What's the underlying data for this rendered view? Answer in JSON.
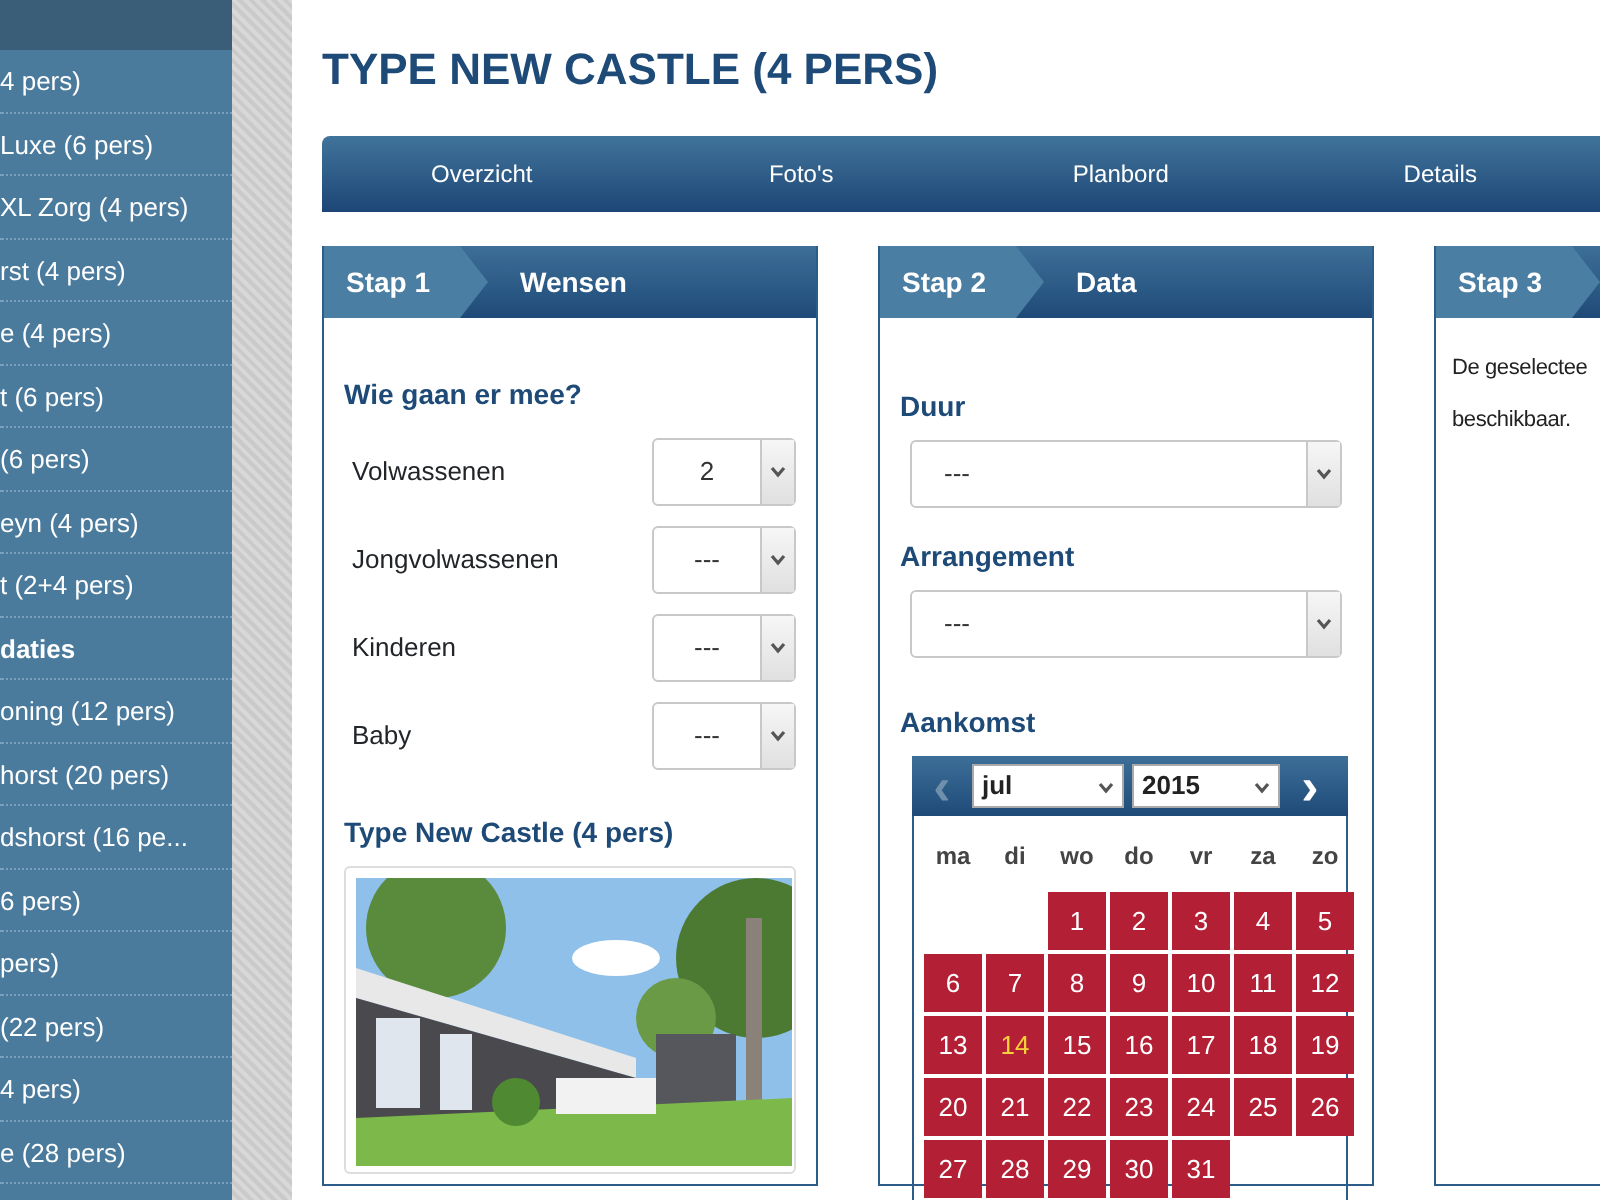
{
  "sidebar": {
    "items": [
      {
        "label": "4 pers)",
        "kind": "link"
      },
      {
        "label": "Luxe (6 pers)",
        "kind": "link"
      },
      {
        "label": "XL Zorg (4 pers)",
        "kind": "link"
      },
      {
        "label": "rst (4 pers)",
        "kind": "link"
      },
      {
        "label": "e (4 pers)",
        "kind": "link"
      },
      {
        "label": "t (6 pers)",
        "kind": "link"
      },
      {
        "label": "(6 pers)",
        "kind": "link"
      },
      {
        "label": "eyn (4 pers)",
        "kind": "link"
      },
      {
        "label": "t (2+4 pers)",
        "kind": "link"
      },
      {
        "label": "daties",
        "kind": "heading"
      },
      {
        "label": "oning (12 pers)",
        "kind": "link"
      },
      {
        "label": "horst (20 pers)",
        "kind": "link"
      },
      {
        "label": "dshorst (16 pe...",
        "kind": "link"
      },
      {
        "label": "6 pers)",
        "kind": "link"
      },
      {
        "label": "pers)",
        "kind": "link"
      },
      {
        "label": "(22 pers)",
        "kind": "link"
      },
      {
        "label": "4 pers)",
        "kind": "link"
      },
      {
        "label": "e (28 pers)",
        "kind": "link"
      }
    ]
  },
  "page_title": "TYPE NEW CASTLE (4 PERS)",
  "tabs": [
    {
      "label": "Overzicht"
    },
    {
      "label": "Foto's"
    },
    {
      "label": "Planbord"
    },
    {
      "label": "Details"
    }
  ],
  "step1": {
    "step": "Stap 1",
    "title": "Wensen",
    "heading": "Wie gaan er mee?",
    "persons": [
      {
        "label": "Volwassenen",
        "value": "2"
      },
      {
        "label": "Jongvolwassenen",
        "value": "---"
      },
      {
        "label": "Kinderen",
        "value": "---"
      },
      {
        "label": "Baby",
        "value": "---"
      }
    ],
    "accommodation": "Type New Castle (4 pers)"
  },
  "step2": {
    "step": "Stap 2",
    "title": "Data",
    "fields": [
      {
        "label": "Duur",
        "value": "---"
      },
      {
        "label": "Arrangement",
        "value": "---"
      }
    ],
    "arrival_label": "Aankomst",
    "calendar": {
      "month": "jul",
      "year": "2015",
      "prev": "‹",
      "next": "›",
      "weekdays": [
        "ma",
        "di",
        "wo",
        "do",
        "vr",
        "za",
        "zo"
      ],
      "days": [
        {
          "day": "1",
          "today": false
        },
        {
          "day": "2",
          "today": false
        },
        {
          "day": "3",
          "today": false
        },
        {
          "day": "4",
          "today": false
        },
        {
          "day": "5",
          "today": false
        },
        {
          "day": "6",
          "today": false
        },
        {
          "day": "7",
          "today": false
        },
        {
          "day": "8",
          "today": false
        },
        {
          "day": "9",
          "today": false
        },
        {
          "day": "10",
          "today": false
        },
        {
          "day": "11",
          "today": false
        },
        {
          "day": "12",
          "today": false
        },
        {
          "day": "13",
          "today": false
        },
        {
          "day": "14",
          "today": true
        },
        {
          "day": "15",
          "today": false
        },
        {
          "day": "16",
          "today": false
        },
        {
          "day": "17",
          "today": false
        },
        {
          "day": "18",
          "today": false
        },
        {
          "day": "19",
          "today": false
        },
        {
          "day": "20",
          "today": false
        },
        {
          "day": "21",
          "today": false
        },
        {
          "day": "22",
          "today": false
        },
        {
          "day": "23",
          "today": false
        },
        {
          "day": "24",
          "today": false
        },
        {
          "day": "25",
          "today": false
        },
        {
          "day": "26",
          "today": false
        },
        {
          "day": "27",
          "today": false
        },
        {
          "day": "28",
          "today": false
        },
        {
          "day": "29",
          "today": false
        },
        {
          "day": "30",
          "today": false
        },
        {
          "day": "31",
          "today": false
        }
      ]
    }
  },
  "step3": {
    "step": "Stap 3",
    "text_lines": [
      "De geselectee",
      "beschikbaar."
    ]
  }
}
